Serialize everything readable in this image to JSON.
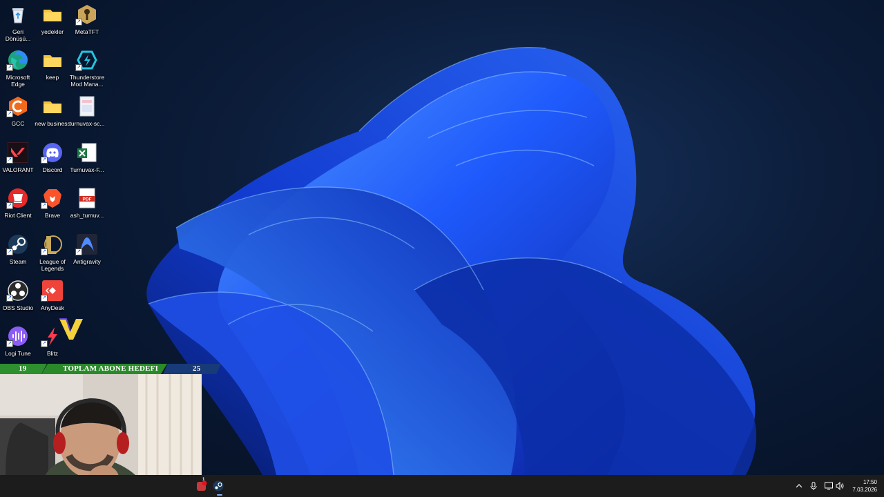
{
  "desktop": {
    "icons": [
      {
        "label": "Geri Dönüşü...",
        "icon": "recycle-bin-icon"
      },
      {
        "label": "yedekler",
        "icon": "folder-icon"
      },
      {
        "label": "MetaTFT",
        "icon": "metatft-icon"
      },
      {
        "label": "Microsoft Edge",
        "icon": "edge-icon"
      },
      {
        "label": "keep",
        "icon": "folder-icon"
      },
      {
        "label": "Thunderstore Mod Mana...",
        "icon": "thunderstore-icon"
      },
      {
        "label": "GCC",
        "icon": "gcc-icon"
      },
      {
        "label": "new business",
        "icon": "folder-icon"
      },
      {
        "label": "turnuvax-sc...",
        "icon": "image-file-icon"
      },
      {
        "label": "VALORANT",
        "icon": "valorant-icon"
      },
      {
        "label": "Discord",
        "icon": "discord-icon"
      },
      {
        "label": "Turnuvax-F...",
        "icon": "excel-file-icon"
      },
      {
        "label": "Riot Client",
        "icon": "riot-client-icon"
      },
      {
        "label": "Brave",
        "icon": "brave-icon"
      },
      {
        "label": "ash_turnuv...",
        "icon": "pdf-file-icon"
      },
      {
        "label": "Steam",
        "icon": "steam-icon"
      },
      {
        "label": "League of Legends",
        "icon": "league-of-legends-icon"
      },
      {
        "label": "Antigravity",
        "icon": "antigravity-icon"
      },
      {
        "label": "OBS Studio",
        "icon": "obs-icon"
      },
      {
        "label": "AnyDesk",
        "icon": "anydesk-icon"
      },
      {
        "label": "Logi Tune",
        "icon": "logi-tune-icon"
      },
      {
        "label": "Blitz",
        "icon": "blitz-icon"
      }
    ]
  },
  "overlay": {
    "current": "19",
    "title": "TOPLAM ABONE HEDEFI",
    "goal": "25",
    "colors": {
      "green": "#2e8f2e",
      "blue": "#173a78"
    }
  },
  "taskbar": {
    "pinned": [
      {
        "icon": "notification-app-icon",
        "badge": "1"
      },
      {
        "icon": "steam-icon"
      }
    ],
    "tray": [
      "chevron-up-icon",
      "microphone-icon",
      "display-icon",
      "speaker-icon"
    ],
    "time": "17:50",
    "date": "7.03.2026"
  },
  "colors": {
    "wallpaper_accent": "#1a5cff",
    "taskbar": "#1c1c1c"
  }
}
